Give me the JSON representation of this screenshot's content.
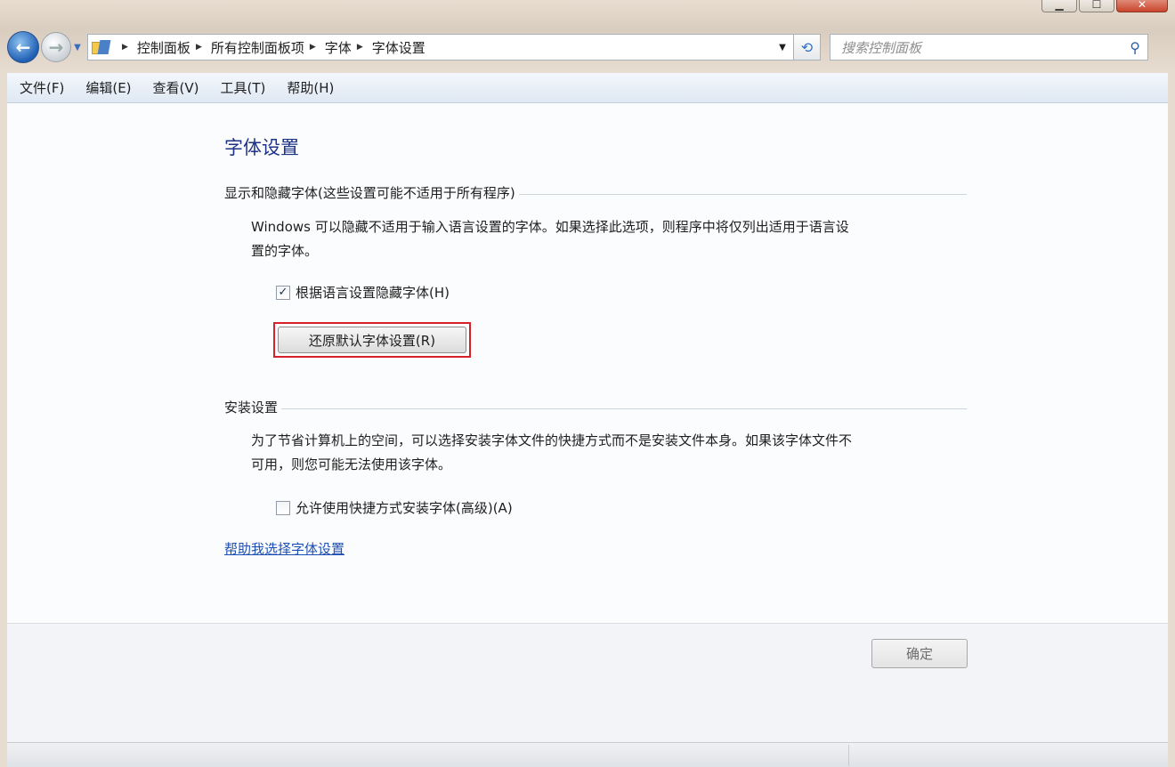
{
  "window": {
    "controls": {
      "minimize": "▁",
      "maximize": "☐",
      "close": "✕"
    }
  },
  "navigation": {
    "back_icon": "back-arrow-icon",
    "forward_icon": "forward-arrow-icon",
    "back_glyph": "←",
    "forward_glyph": "→",
    "history_dropdown_glyph": "▼",
    "breadcrumbs": [
      "控制面板",
      "所有控制面板项",
      "字体",
      "字体设置"
    ],
    "separator_glyph": "▶",
    "address_dropdown_glyph": "▼",
    "refresh_glyph": "⟲",
    "search": {
      "placeholder": "搜索控制面板",
      "icon_glyph": "⚲"
    }
  },
  "menubar": {
    "items": [
      "文件(F)",
      "编辑(E)",
      "查看(V)",
      "工具(T)",
      "帮助(H)"
    ]
  },
  "content": {
    "title": "字体设置",
    "section1": {
      "heading": "显示和隐藏字体(这些设置可能不适用于所有程序)",
      "paragraph_line1": "Windows 可以隐藏不适用于输入语言设置的字体。如果选择此选项，则程序中将仅列出适用于语言设",
      "paragraph_line2": "置的字体。",
      "checkbox_label": "根据语言设置隐藏字体(H)",
      "checkbox_checked": true,
      "checkbox_glyph": "✓",
      "restore_button": "还原默认字体设置(R)"
    },
    "section2": {
      "heading": "安装设置",
      "paragraph_line1": "为了节省计算机上的空间，可以选择安装字体文件的快捷方式而不是安装文件本身。如果该字体文件不",
      "paragraph_line2": "可用，则您可能无法使用该字体。",
      "checkbox_label": "允许使用快捷方式安装字体(高级)(A)",
      "checkbox_checked": false
    },
    "help_link": "帮助我选择字体设置"
  },
  "footer": {
    "ok_button": "确定"
  },
  "colors": {
    "title": "#1e3287",
    "link": "#1d4fb4",
    "highlight_border": "#d7202a"
  }
}
